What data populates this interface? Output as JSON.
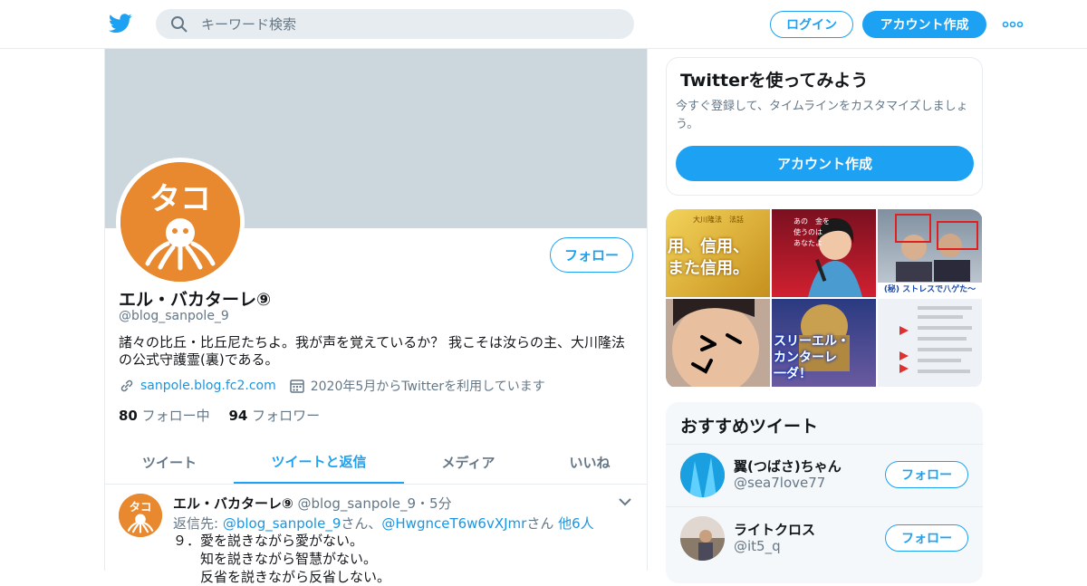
{
  "header": {
    "search_placeholder": "キーワード検索",
    "login_label": "ログイン",
    "signup_label": "アカウント作成",
    "brand_color": "#1da1f2"
  },
  "profile": {
    "avatar_text": "タコ",
    "follow_label": "フォロー",
    "name": "エル・バカターレ⑨",
    "handle": "@blog_sanpole_9",
    "bio": "諸々の比丘・比丘尼たちよ。我が声を覚えているか？ 我こそは汝らの主、大川隆法の公式守護霊(裏)である。",
    "website": "sanpole.blog.fc2.com",
    "joined": "2020年5月からTwitterを利用しています",
    "following_count": "80",
    "following_label": "フォロー中",
    "followers_count": "94",
    "followers_label": "フォロワー"
  },
  "tabs": [
    {
      "label": "ツイート",
      "active": false
    },
    {
      "label": "ツイートと返信",
      "active": true
    },
    {
      "label": "メディア",
      "active": false
    },
    {
      "label": "いいね",
      "active": false
    }
  ],
  "tweet": {
    "name": "エル・バカターレ⑨",
    "handle": "@blog_sanpole_9",
    "time": "・5分",
    "reply_prefix": "返信先: ",
    "reply_to_1": "@blog_sanpole_9",
    "reply_san_1": "さん、",
    "reply_to_2": "@HwgnceT6w6vXJmr",
    "reply_san_2": "さん ",
    "reply_others": "他6人",
    "body": "９．愛を説きながら愛がない。\n　　知を説きながら智慧がない。\n　　反省を説きながら反省しない。"
  },
  "side": {
    "card_title": "Twitterを使ってみよう",
    "card_text": "今すぐ登録して、タイムラインをカスタマイズしましょう。",
    "card_cta": "アカウント作成",
    "media_captions": {
      "m1_top": "大川隆法　法話",
      "m1_main": "用、信用、\nまた信用。",
      "m2_text": "あの　金を\n使うのは\nあなたよ",
      "m3_caption": "(秘) ストレスで八ゲた～",
      "m5_text": "スリーエル・\nカンターレ\n一ダ！"
    },
    "rec_title": "おすすめツイート",
    "rec_users": [
      {
        "name": "翼(つばさ)ちゃん",
        "handle": "@sea7love77",
        "button": "フォロー"
      },
      {
        "name": "ライトクロス",
        "handle": "@it5_q",
        "button": "フォロー"
      }
    ]
  }
}
